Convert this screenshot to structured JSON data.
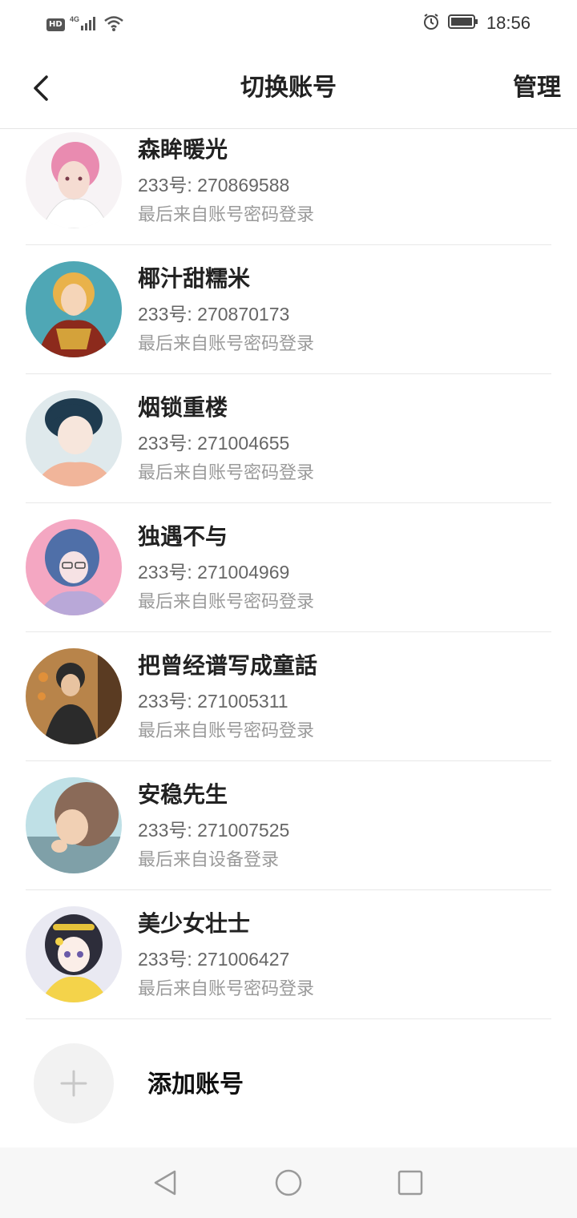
{
  "status_bar": {
    "left_badge": "HD",
    "network": "4G",
    "time": "18:56",
    "icons": [
      "hd-icon",
      "signal-icon",
      "wifi-icon",
      "alarm-icon",
      "battery-icon"
    ]
  },
  "header": {
    "title": "切换账号",
    "manage_label": "管理",
    "back_icon": "chevron-left-icon"
  },
  "accounts": [
    {
      "name": "森眸暖光",
      "id": "233号: 270869588",
      "login": "最后来自账号密码登录",
      "avatar_colors": [
        "#f2c6d4",
        "#e98bb0"
      ]
    },
    {
      "name": "椰汁甜糯米",
      "id": "233号: 270870173",
      "login": "最后来自账号密码登录",
      "avatar_colors": [
        "#e9b24a",
        "#8c2a1c"
      ]
    },
    {
      "name": "烟锁重楼",
      "id": "233号: 271004655",
      "login": "最后来自账号密码登录",
      "avatar_colors": [
        "#1f3b4f",
        "#f1b59a"
      ]
    },
    {
      "name": "独遇不与",
      "id": "233号: 271004969",
      "login": "最后来自账号密码登录",
      "avatar_colors": [
        "#f4a7c2",
        "#4f6fa8"
      ]
    },
    {
      "name": "把曾经谱写成童話",
      "id": "233号: 271005311",
      "login": "最后来自账号密码登录",
      "avatar_colors": [
        "#b8844a",
        "#2b2b2b"
      ]
    },
    {
      "name": "安稳先生",
      "id": "233号: 271007525",
      "login": "最后来自设备登录",
      "avatar_colors": [
        "#8a6a58",
        "#bfe0e6"
      ]
    },
    {
      "name": "美少女壮士",
      "id": "233号: 271006427",
      "login": "最后来自账号密码登录",
      "avatar_colors": [
        "#2d2d3a",
        "#e9e9f2"
      ]
    }
  ],
  "add_account": {
    "label": "添加账号",
    "icon": "plus-icon"
  },
  "system_nav": {
    "icons": [
      "back-triangle-icon",
      "home-circle-icon",
      "recents-square-icon"
    ]
  }
}
